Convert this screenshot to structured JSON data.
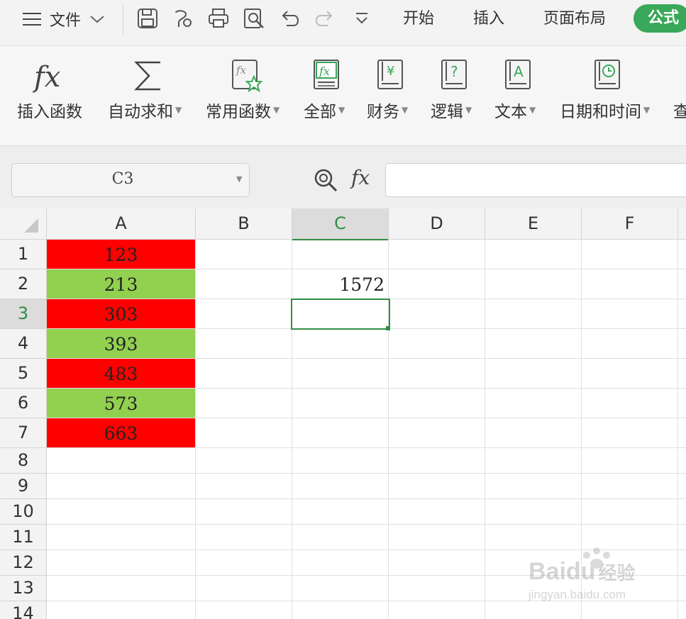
{
  "titlebar": {
    "file_menu": "文件",
    "tabs": [
      "开始",
      "插入",
      "页面布局"
    ],
    "active_tab": "公式"
  },
  "ribbon": {
    "items": [
      {
        "label": "插入函数",
        "icon": "fx-icon",
        "caret": false
      },
      {
        "label": "自动求和",
        "icon": "sigma-icon",
        "caret": true
      },
      {
        "label": "常用函数",
        "icon": "star-function-icon",
        "caret": true
      },
      {
        "label": "全部",
        "icon": "fx-book-icon",
        "caret": true
      },
      {
        "label": "财务",
        "icon": "yen-book-icon",
        "caret": true
      },
      {
        "label": "逻辑",
        "icon": "question-book-icon",
        "caret": true
      },
      {
        "label": "文本",
        "icon": "text-book-icon",
        "caret": true
      },
      {
        "label": "日期和时间",
        "icon": "clock-book-icon",
        "caret": true
      },
      {
        "label": "查",
        "icon": "",
        "caret": false
      }
    ]
  },
  "formula_bar": {
    "name_box": "C3",
    "fx_label": "fx",
    "formula": ""
  },
  "sheet": {
    "columns": [
      "A",
      "B",
      "C",
      "D",
      "E",
      "F"
    ],
    "rows": [
      "1",
      "2",
      "3",
      "4",
      "5",
      "6",
      "7",
      "8",
      "9",
      "10",
      "11",
      "12",
      "13",
      "14"
    ],
    "selected_cell": "C3",
    "colA": [
      {
        "value": "123",
        "fill": "#ff0000"
      },
      {
        "value": "213",
        "fill": "#92d050"
      },
      {
        "value": "303",
        "fill": "#ff0000"
      },
      {
        "value": "393",
        "fill": "#92d050"
      },
      {
        "value": "483",
        "fill": "#ff0000"
      },
      {
        "value": "573",
        "fill": "#92d050"
      },
      {
        "value": "663",
        "fill": "#ff0000"
      }
    ],
    "c2": "1572"
  },
  "watermark": {
    "brand": "Baidu",
    "suffix": "经验",
    "url": "jingyan.baidu.com"
  }
}
